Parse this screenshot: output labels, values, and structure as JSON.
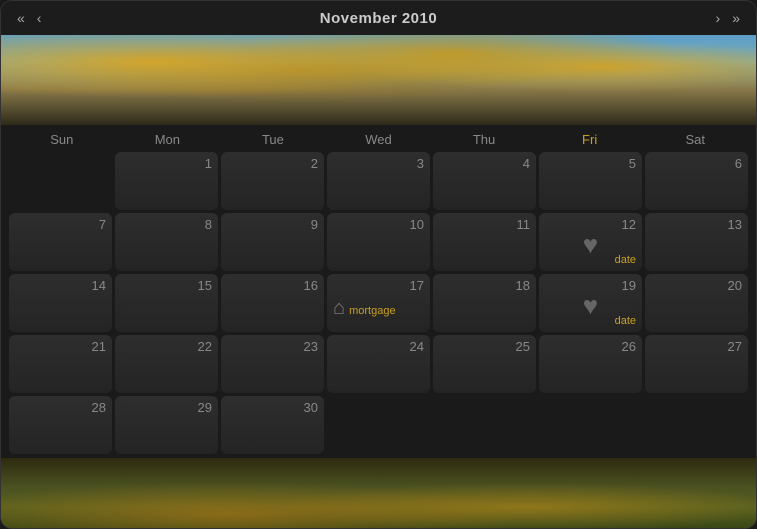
{
  "header": {
    "title": "November 2010",
    "prev_single": "‹",
    "prev_double": "«",
    "next_single": "›",
    "next_double": "»"
  },
  "dayHeaders": [
    "Sun",
    "Mon",
    "Tue",
    "Wed",
    "Thu",
    "Fri",
    "Sat"
  ],
  "highlightDayIndex": 5,
  "weeks": [
    [
      {
        "num": "",
        "outside": true
      },
      {
        "num": "1"
      },
      {
        "num": "2"
      },
      {
        "num": "3"
      },
      {
        "num": "4"
      },
      {
        "num": "5"
      },
      {
        "num": "6"
      }
    ],
    [
      {
        "num": "7"
      },
      {
        "num": "8"
      },
      {
        "num": "9"
      },
      {
        "num": "10"
      },
      {
        "num": "11"
      },
      {
        "num": "12",
        "event": "date",
        "icon": "heart"
      },
      {
        "num": "13"
      }
    ],
    [
      {
        "num": "14"
      },
      {
        "num": "15"
      },
      {
        "num": "16"
      },
      {
        "num": "17",
        "event": "mortgage",
        "icon": "house"
      },
      {
        "num": "18"
      },
      {
        "num": "19",
        "event": "date",
        "icon": "heart"
      },
      {
        "num": "20"
      }
    ],
    [
      {
        "num": "21"
      },
      {
        "num": "22"
      },
      {
        "num": "23"
      },
      {
        "num": "24"
      },
      {
        "num": "25"
      },
      {
        "num": "26"
      },
      {
        "num": "27"
      }
    ],
    [
      {
        "num": "28"
      },
      {
        "num": "29"
      },
      {
        "num": "30"
      },
      {
        "num": "",
        "outside": true
      },
      {
        "num": "",
        "outside": true
      },
      {
        "num": "",
        "outside": true
      },
      {
        "num": "",
        "outside": true
      }
    ]
  ]
}
